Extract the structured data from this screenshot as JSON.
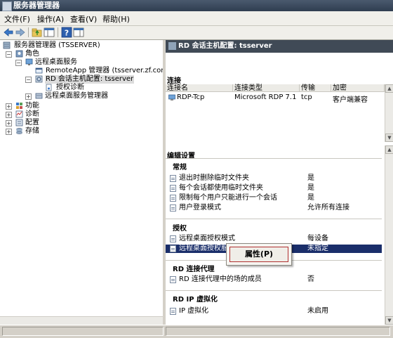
{
  "window": {
    "title": "服务器管理器"
  },
  "menu": [
    "文件(F)",
    "操作(A)",
    "查看(V)",
    "帮助(H)"
  ],
  "toolbar": {
    "icons": [
      "back-icon",
      "forward-icon",
      "up-folder-icon",
      "show-hide-tree-icon",
      "help-icon",
      "properties-icon"
    ]
  },
  "tree": {
    "root": "服务器管理器 (TSSERVER)",
    "roles": "角色",
    "rds": "远程桌面服务",
    "remoteapp": "RemoteApp 管理器 (tsserver.zf.com)",
    "rdconfig": "RD 会话主机配置: tsserver",
    "licensing": "授权诊断",
    "rdsmanager": "远程桌面服务管理器",
    "features": "功能",
    "diagnostics": "诊断",
    "configuration": "配置",
    "storage": "存储"
  },
  "right": {
    "header": "RD 会话主机配置: tsserver",
    "connections_title": "连接",
    "columns": [
      "连接名",
      "连接类型",
      "传输",
      "加密"
    ],
    "connection": {
      "name": "RDP-Tcp",
      "type": "Microsoft RDP 7.1",
      "transport": "tcp",
      "encryption": "客户端兼容"
    },
    "edit_title": "编辑设置",
    "general_title": "常规",
    "general": [
      {
        "name": "退出时删除临时文件夹",
        "value": "是"
      },
      {
        "name": "每个会话都使用临时文件夹",
        "value": "是"
      },
      {
        "name": "限制每个用户只能进行一个会话",
        "value": "是"
      },
      {
        "name": "用户登录模式",
        "value": "允许所有连接"
      }
    ],
    "licensing_title": "授权",
    "licensing": [
      {
        "name": "远程桌面授权模式",
        "value": "每设备"
      },
      {
        "name": "远程桌面授权服务器",
        "value": "未指定"
      }
    ],
    "broker_title": "RD 连接代理",
    "broker": [
      {
        "name": "RD 连接代理中的场的成员",
        "value": "否"
      }
    ],
    "ipv_title": "RD IP 虚拟化",
    "ipv": [
      {
        "name": "IP 虚拟化",
        "value": "未启用"
      }
    ]
  },
  "context_menu": {
    "item": "属性(P)"
  }
}
